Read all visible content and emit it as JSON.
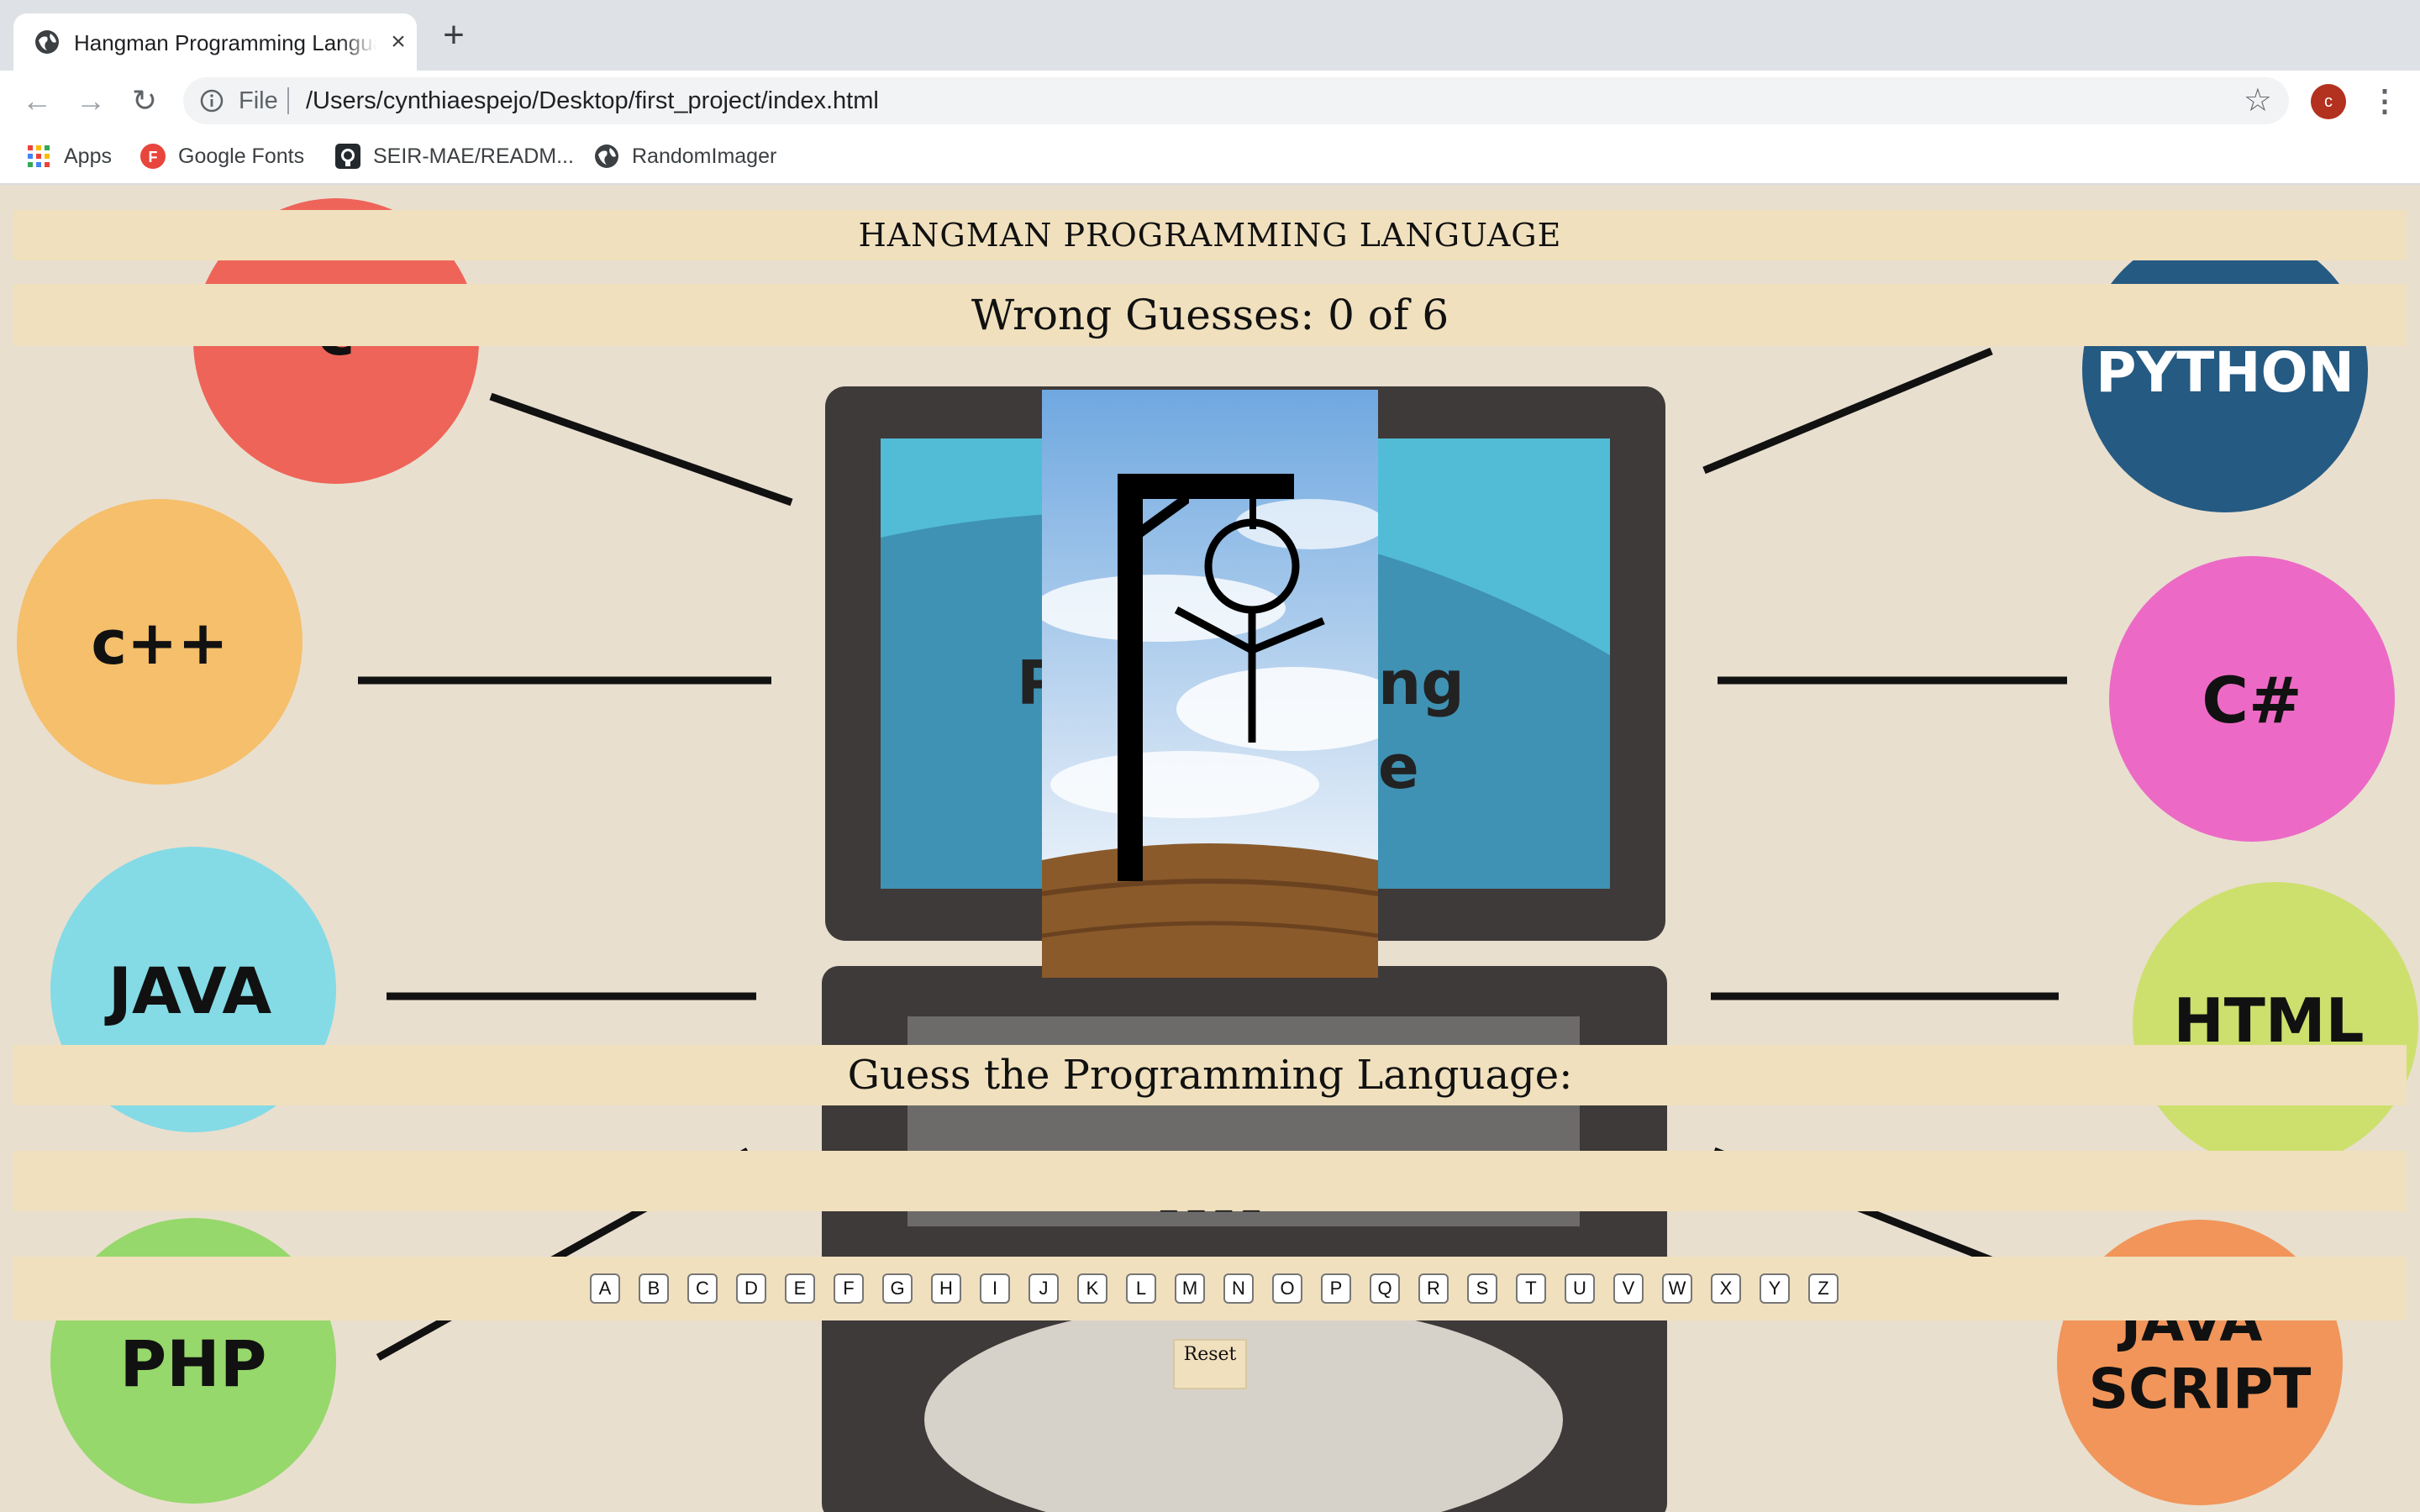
{
  "browser": {
    "tab_title": "Hangman Programming Language",
    "tab_close": "×",
    "new_tab": "+",
    "back": "←",
    "forward": "→",
    "reload": "↻",
    "url_scheme": "File",
    "url": "/Users/cynthiaespejo/Desktop/first_project/index.html",
    "bookmark_star": "☆",
    "avatar_initial": "c",
    "menu": "⋮",
    "bookmarks": [
      {
        "label": "Apps",
        "icon": "apps-grid-icon"
      },
      {
        "label": "Google Fonts",
        "icon": "google-fonts-icon"
      },
      {
        "label": "SEIR-MAE/READM...",
        "icon": "github-icon"
      },
      {
        "label": "RandomImager",
        "icon": "globe-icon"
      }
    ]
  },
  "game": {
    "title": "HANGMAN PROGRAMMING LANGUAGE",
    "wrong_guesses": "Wrong Guesses: 0 of 6",
    "prompt": "Guess the Programming Language:",
    "blanks": "_ _ _ _",
    "letters": [
      "A",
      "B",
      "C",
      "D",
      "E",
      "F",
      "G",
      "H",
      "I",
      "J",
      "K",
      "L",
      "M",
      "N",
      "O",
      "P",
      "Q",
      "R",
      "S",
      "T",
      "U",
      "V",
      "W",
      "X",
      "Y",
      "Z"
    ],
    "reset_label": "Reset"
  },
  "background": {
    "languages": [
      {
        "label": "c",
        "color": "#ee6459"
      },
      {
        "label": "c++",
        "color": "#f5bf6b"
      },
      {
        "label": "JAVA",
        "color": "#84dbe6"
      },
      {
        "label": "PHP",
        "color": "#96d86b"
      },
      {
        "label": "PYTHON",
        "color": "#255a82"
      },
      {
        "label": "C#",
        "color": "#ec6ac5"
      },
      {
        "label": "HTML",
        "color": "#cde06e"
      },
      {
        "label": "JAVA",
        "color": "#f1955a"
      },
      {
        "label": "SCRIPT",
        "color": "#f1955a"
      }
    ],
    "laptop_text_1": "P",
    "laptop_text_2": "ng",
    "laptop_text_3": "e"
  },
  "colors": {
    "page_bg": "#e9dfcf",
    "band_bg": "#f0e0bd"
  }
}
